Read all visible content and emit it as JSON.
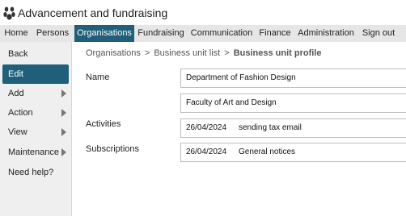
{
  "app": {
    "title": "Advancement and fundraising",
    "logo_icon": "paw-logo-icon"
  },
  "topnav": {
    "items": [
      {
        "label": "Home"
      },
      {
        "label": "Persons"
      },
      {
        "label": "Organisations",
        "active": true
      },
      {
        "label": "Fundraising"
      },
      {
        "label": "Communication"
      },
      {
        "label": "Finance"
      },
      {
        "label": "Administration"
      },
      {
        "label": "Sign out"
      }
    ]
  },
  "sidebar": {
    "items": [
      {
        "label": "Back"
      },
      {
        "label": "Edit",
        "active": true
      },
      {
        "label": "Add",
        "has_submenu": true
      },
      {
        "label": "Action",
        "has_submenu": true
      },
      {
        "label": "View",
        "has_submenu": true
      },
      {
        "label": "Maintenance",
        "has_submenu": true
      },
      {
        "label": "Need help?"
      }
    ]
  },
  "breadcrumb": {
    "items": [
      "Organisations",
      "Business unit list"
    ],
    "separator": ">",
    "current": "Business unit profile"
  },
  "fields": {
    "name_label": "Name",
    "name_values": [
      "Department of Fashion Design",
      "Faculty of Art and Design"
    ],
    "activities_label": "Activities",
    "activities": [
      {
        "date": "26/04/2024",
        "text": "sending tax email"
      }
    ],
    "subscriptions_label": "Subscriptions",
    "subscriptions": [
      {
        "date": "26/04/2024",
        "text": "General notices"
      }
    ]
  },
  "colors": {
    "accent": "#1f5f79",
    "nav_bg": "#e6e6e6",
    "sidebar_bg": "#efefef"
  }
}
